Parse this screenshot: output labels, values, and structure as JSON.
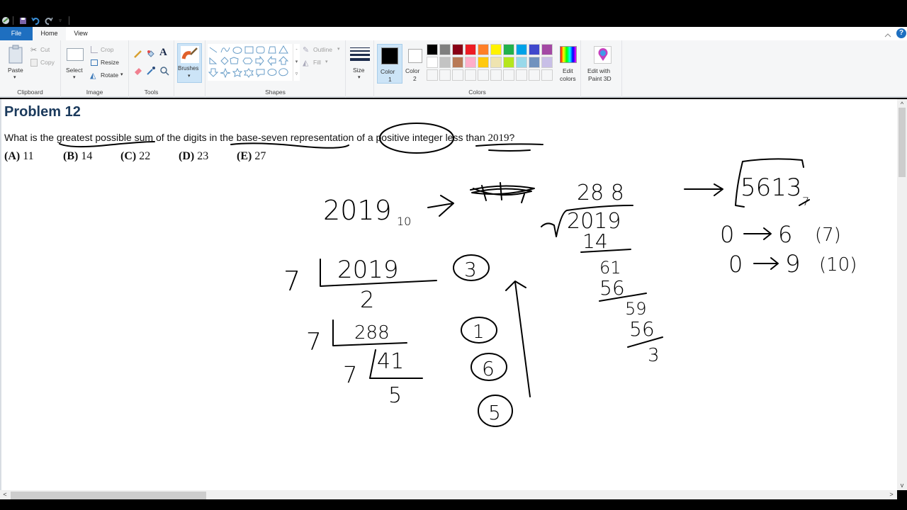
{
  "quick_access": {
    "app_icon": "paint-icon",
    "save_icon": "save-icon",
    "undo_icon": "undo-icon",
    "redo_icon": "redo-icon",
    "customize_icon": "chevron-down-icon"
  },
  "menu": {
    "tabs": [
      {
        "label": "File"
      },
      {
        "label": "Home"
      },
      {
        "label": "View"
      }
    ],
    "active": "Home",
    "collapse_icon": "chevron-up-icon",
    "help_icon": "help-icon",
    "help_glyph": "?"
  },
  "ribbon": {
    "clipboard": {
      "label": "Clipboard",
      "paste": "Paste",
      "cut": "Cut",
      "copy": "Copy"
    },
    "image": {
      "label": "Image",
      "select": "Select",
      "crop": "Crop",
      "resize": "Resize",
      "rotate": "Rotate"
    },
    "tools": {
      "label": "Tools"
    },
    "brushes": {
      "label": "Brushes"
    },
    "shapes": {
      "label": "Shapes",
      "outline": "Outline",
      "fill": "Fill"
    },
    "size": {
      "label": "Size"
    },
    "colors": {
      "label": "Colors",
      "color1": "Color 1",
      "color1_line1": "Color",
      "color1_line2": "1",
      "color2_line1": "Color",
      "color2_line2": "2",
      "color1_value": "#000000",
      "color2_value": "#ffffff",
      "palette_row1": [
        "#000000",
        "#7f7f7f",
        "#880015",
        "#ed1c24",
        "#ff7f27",
        "#fff200",
        "#22b14c",
        "#00a2e8",
        "#3f48cc",
        "#a349a4"
      ],
      "palette_row2": [
        "#ffffff",
        "#c3c3c3",
        "#b97a57",
        "#ffaec9",
        "#ffc90e",
        "#efe4b0",
        "#b5e61d",
        "#99d9ea",
        "#7092be",
        "#c8bfe7"
      ],
      "edit_colors_line1": "Edit",
      "edit_colors_line2": "colors"
    },
    "paint3d": {
      "line1": "Edit with",
      "line2": "Paint 3D"
    }
  },
  "document": {
    "title": "Problem 12",
    "question_parts": [
      "What is the greatest possible sum of the digits in the base-seven representation of a positive integer less than ",
      "2019",
      "?"
    ],
    "choices": [
      {
        "letter": "(A)",
        "value": "11"
      },
      {
        "letter": "(B)",
        "value": "14"
      },
      {
        "letter": "(C)",
        "value": "22"
      },
      {
        "letter": "(D)",
        "value": "23"
      },
      {
        "letter": "(E)",
        "value": "27"
      }
    ]
  },
  "handwriting": {
    "base10": "2019",
    "base10_sub": "10",
    "scribbled": "5613",
    "quotient_top": "28 8",
    "long_div_dividend": "2019",
    "long_div_divisor": "7",
    "steps": [
      "14",
      "61",
      "56",
      "59",
      "56",
      "3"
    ],
    "result": "5613",
    "result_sub": "7",
    "digit_range_base7": [
      "0",
      "6",
      "(7)"
    ],
    "digit_range_base10": [
      "0",
      "9",
      "(10)"
    ],
    "short_div": [
      {
        "divisor": "7",
        "dividend": "2019",
        "remainder": "3"
      },
      {
        "divisor": "",
        "dividend": "2",
        "remainder": ""
      },
      {
        "divisor": "7",
        "dividend": "288",
        "remainder": "1"
      },
      {
        "divisor": "7",
        "dividend": "41",
        "remainder": "6"
      },
      {
        "divisor": "",
        "dividend": "5",
        "remainder": "5"
      }
    ]
  },
  "scrollbars": {
    "up": "^",
    "down": "v",
    "left": "<",
    "right": ">"
  }
}
